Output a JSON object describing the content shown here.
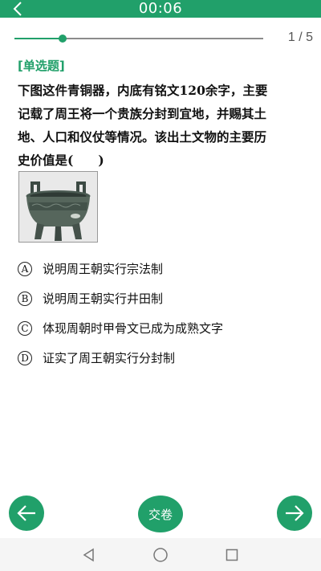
{
  "header": {
    "timer": "00:06",
    "back_icon": "chevron-left-icon"
  },
  "progress": {
    "current": 1,
    "total": 5,
    "fraction": 0.2,
    "counter_text": "1 / 5"
  },
  "question": {
    "type_label": "[单选题]",
    "lines": [
      "下图这件青铜器，内底有铭文120余字，主要",
      "记载了周王将一个贵族分封到宜地，并赐其土",
      "地、人口和仪仗等情况。该出土文物的主要历",
      "史价值是(　　)"
    ],
    "image": "bronze-vessel-photo"
  },
  "options": [
    {
      "letter": "A",
      "text": "说明周王朝实行宗法制"
    },
    {
      "letter": "B",
      "text": "说明周王朝实行井田制"
    },
    {
      "letter": "C",
      "text": "体现周朝时甲骨文已成为成熟文字"
    },
    {
      "letter": "D",
      "text": "证实了周王朝实行分封制"
    }
  ],
  "footer": {
    "prev_icon": "arrow-left-icon",
    "submit_label": "交卷",
    "next_icon": "arrow-right-icon"
  },
  "system_nav": [
    "back-triangle-icon",
    "home-circle-icon",
    "recents-square-icon"
  ],
  "colors": {
    "accent": "#21a06a",
    "track": "#8c8c8c",
    "text": "#111111"
  }
}
